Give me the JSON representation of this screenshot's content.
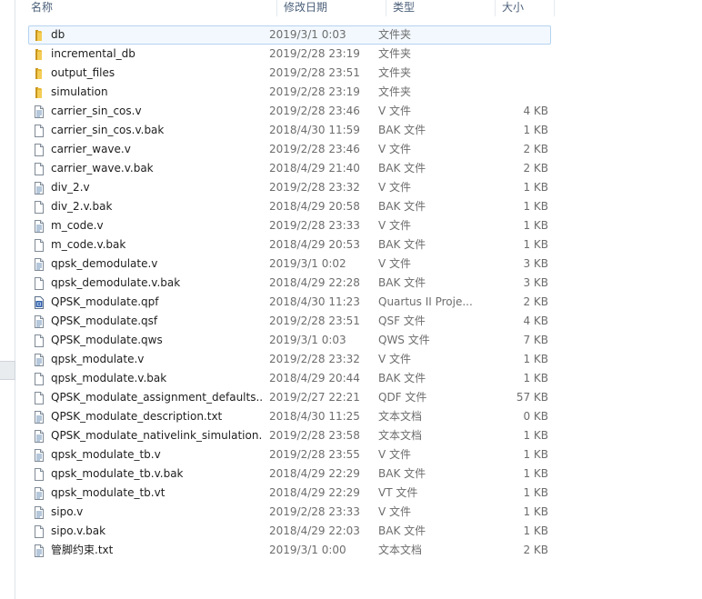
{
  "columns": {
    "name": "名称",
    "date": "修改日期",
    "type": "类型",
    "size": "大小"
  },
  "rows": [
    {
      "name": "db",
      "date": "2019/3/1 0:03",
      "type": "文件夹",
      "size": "",
      "icon": "folder-icon",
      "selected": true
    },
    {
      "name": "incremental_db",
      "date": "2019/2/28 23:19",
      "type": "文件夹",
      "size": "",
      "icon": "folder-icon"
    },
    {
      "name": "output_files",
      "date": "2019/2/28 23:51",
      "type": "文件夹",
      "size": "",
      "icon": "folder-icon"
    },
    {
      "name": "simulation",
      "date": "2019/2/28 23:19",
      "type": "文件夹",
      "size": "",
      "icon": "folder-icon"
    },
    {
      "name": "carrier_sin_cos.v",
      "date": "2019/2/28 23:46",
      "type": "V 文件",
      "size": "4 KB",
      "icon": "text-file-icon"
    },
    {
      "name": "carrier_sin_cos.v.bak",
      "date": "2018/4/30 11:59",
      "type": "BAK 文件",
      "size": "1 KB",
      "icon": "blank-file-icon"
    },
    {
      "name": "carrier_wave.v",
      "date": "2019/2/28 23:46",
      "type": "V 文件",
      "size": "2 KB",
      "icon": "blank-file-icon"
    },
    {
      "name": "carrier_wave.v.bak",
      "date": "2018/4/29 21:40",
      "type": "BAK 文件",
      "size": "2 KB",
      "icon": "blank-file-icon"
    },
    {
      "name": "div_2.v",
      "date": "2019/2/28 23:32",
      "type": "V 文件",
      "size": "1 KB",
      "icon": "text-file-icon"
    },
    {
      "name": "div_2.v.bak",
      "date": "2018/4/29 20:58",
      "type": "BAK 文件",
      "size": "1 KB",
      "icon": "blank-file-icon"
    },
    {
      "name": "m_code.v",
      "date": "2019/2/28 23:33",
      "type": "V 文件",
      "size": "1 KB",
      "icon": "text-file-icon"
    },
    {
      "name": "m_code.v.bak",
      "date": "2018/4/29 20:53",
      "type": "BAK 文件",
      "size": "1 KB",
      "icon": "blank-file-icon"
    },
    {
      "name": "qpsk_demodulate.v",
      "date": "2019/3/1 0:02",
      "type": "V 文件",
      "size": "3 KB",
      "icon": "text-file-icon"
    },
    {
      "name": "qpsk_demodulate.v.bak",
      "date": "2018/4/29 22:28",
      "type": "BAK 文件",
      "size": "3 KB",
      "icon": "blank-file-icon"
    },
    {
      "name": "QPSK_modulate.qpf",
      "date": "2018/4/30 11:23",
      "type": "Quartus II Proje...",
      "size": "2 KB",
      "icon": "quartus-project-icon"
    },
    {
      "name": "QPSK_modulate.qsf",
      "date": "2019/2/28 23:51",
      "type": "QSF 文件",
      "size": "4 KB",
      "icon": "text-file-icon"
    },
    {
      "name": "QPSK_modulate.qws",
      "date": "2019/3/1 0:03",
      "type": "QWS 文件",
      "size": "7 KB",
      "icon": "blank-file-icon"
    },
    {
      "name": "qpsk_modulate.v",
      "date": "2019/2/28 23:32",
      "type": "V 文件",
      "size": "1 KB",
      "icon": "text-file-icon"
    },
    {
      "name": "qpsk_modulate.v.bak",
      "date": "2018/4/29 20:44",
      "type": "BAK 文件",
      "size": "1 KB",
      "icon": "blank-file-icon"
    },
    {
      "name": "QPSK_modulate_assignment_defaults....",
      "date": "2019/2/27 22:21",
      "type": "QDF 文件",
      "size": "57 KB",
      "icon": "blank-file-icon"
    },
    {
      "name": "QPSK_modulate_description.txt",
      "date": "2018/4/30 11:25",
      "type": "文本文档",
      "size": "0 KB",
      "icon": "text-file-icon"
    },
    {
      "name": "QPSK_modulate_nativelink_simulation...",
      "date": "2019/2/28 23:58",
      "type": "文本文档",
      "size": "1 KB",
      "icon": "text-file-icon"
    },
    {
      "name": "qpsk_modulate_tb.v",
      "date": "2019/2/28 23:55",
      "type": "V 文件",
      "size": "1 KB",
      "icon": "text-file-icon"
    },
    {
      "name": "qpsk_modulate_tb.v.bak",
      "date": "2018/4/29 22:29",
      "type": "BAK 文件",
      "size": "1 KB",
      "icon": "blank-file-icon"
    },
    {
      "name": "qpsk_modulate_tb.vt",
      "date": "2018/4/29 22:29",
      "type": "VT 文件",
      "size": "1 KB",
      "icon": "text-file-icon"
    },
    {
      "name": "sipo.v",
      "date": "2019/2/28 23:33",
      "type": "V 文件",
      "size": "1 KB",
      "icon": "text-file-icon"
    },
    {
      "name": "sipo.v.bak",
      "date": "2018/4/29 22:03",
      "type": "BAK 文件",
      "size": "1 KB",
      "icon": "blank-file-icon"
    },
    {
      "name": "管脚约束.txt",
      "date": "2019/3/1 0:00",
      "type": "文本文档",
      "size": "2 KB",
      "icon": "text-file-icon"
    }
  ],
  "colors": {
    "folder": "#e8b934",
    "header_text": "#4c607a",
    "selection_bg": "#f2f8fe",
    "selection_border": "#b6d3f0"
  }
}
